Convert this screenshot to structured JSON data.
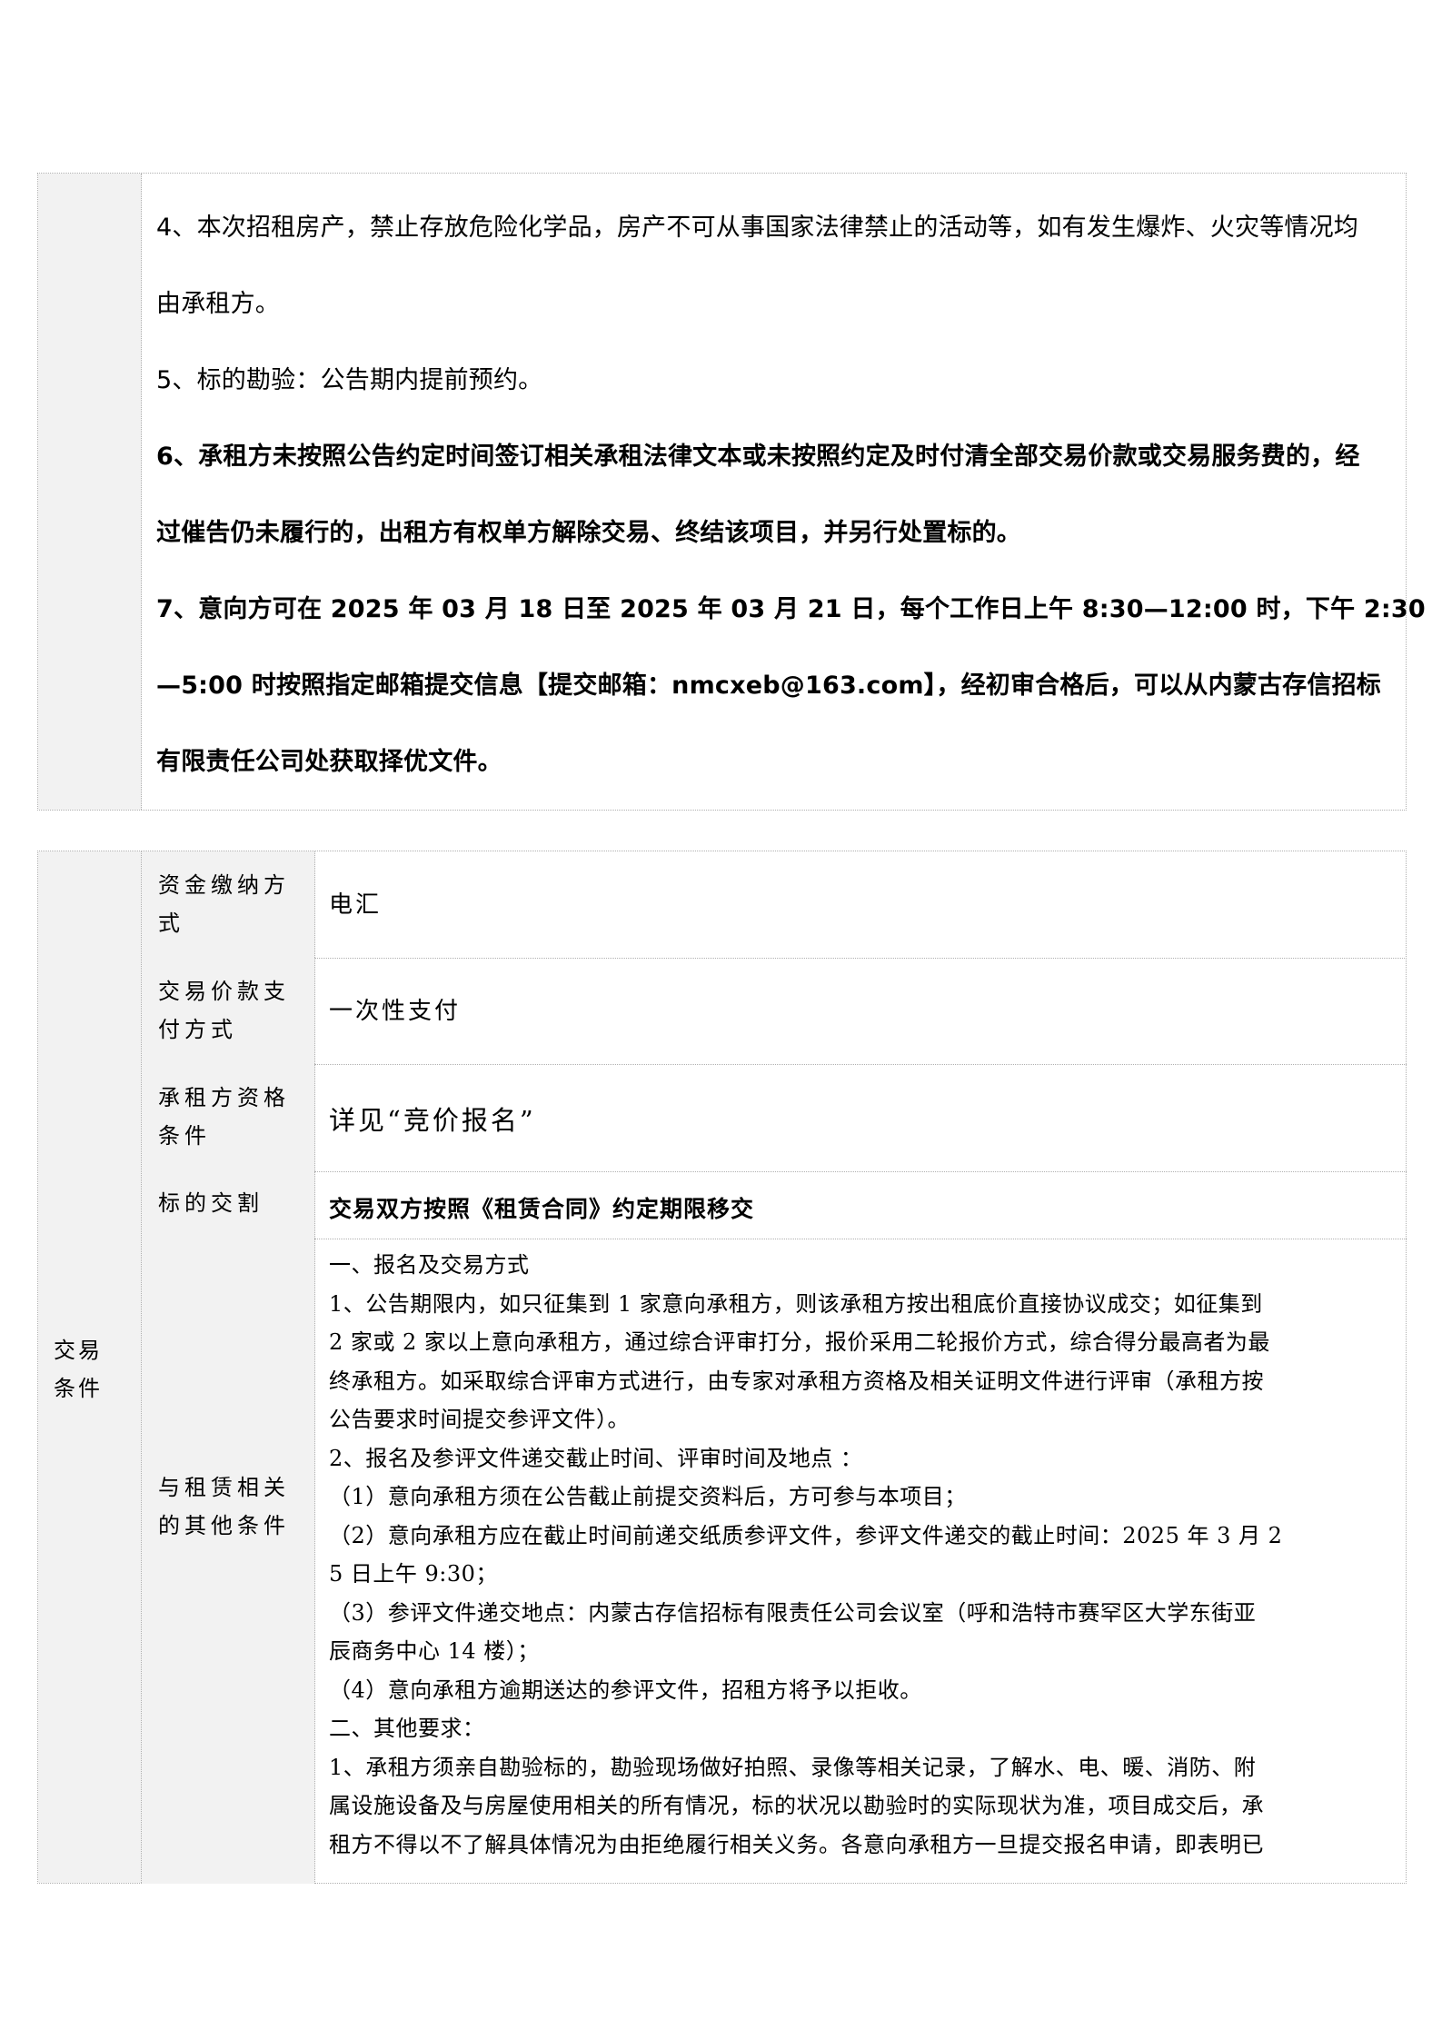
{
  "terms": {
    "l1": "4、本次招租房产，禁止存放危险化学品，房产不可从事国家法律禁止的活动等，如有发生爆炸、火灾等情况均",
    "l2": "由承租方。",
    "l3": "5、标的勘验：公告期内提前预约。",
    "l4": "6、承租方未按照公告约定时间签订相关承租法律文本或未按照约定及时付清全部交易价款或交易服务费的，经",
    "l5": "过催告仍未履行的，出租方有权单方解除交易、终结该项目，并另行处置标的。",
    "l6": "7、意向方可在 2025 年 03 月 18 日至 2025 年 03 月 21 日，每个工作日上午 8:30—12:00  时，下午  2:30",
    "l7": "—5:00  时按照指定邮箱提交信息【提交邮箱：nmcxeb@163.com】，经初审合格后，可以从内蒙古存信招标",
    "l8": "有限责任公司处获取择优文件。"
  },
  "trade": {
    "section_label_1": "交易",
    "section_label_2": "条件",
    "rows": {
      "payment_method_label": "资金缴纳方式",
      "payment_method_value": "电汇",
      "price_payment_label": "交易价款支付方式",
      "price_payment_value": "一次性支付",
      "qualification_label": "承租方资格条件",
      "qualification_value": "详见“竞价报名”",
      "delivery_label": "标的交割",
      "delivery_value": "交易双方按照《租赁合同》约定期限移交",
      "other_label": "与租赁相关的其他条件"
    },
    "other_lines": [
      "一、报名及交易方式",
      "1、公告期限内，如只征集到 1 家意向承租方，则该承租方按出租底价直接协议成交；如征集到",
      "2 家或 2 家以上意向承租方，通过综合评审打分，报价采用二轮报价方式，综合得分最高者为最",
      "终承租方。如采取综合评审方式进行，由专家对承租方资格及相关证明文件进行评审（承租方按",
      "公告要求时间提交参评文件）。",
      "2、报名及参评文件递交截止时间、评审时间及地点 ：",
      "（1）意向承租方须在公告截止前提交资料后，方可参与本项目；",
      "（2）意向承租方应在截止时间前递交纸质参评文件，参评文件递交的截止时间：2025 年 3 月 2",
      "5 日上午 9:30；",
      "（3）参评文件递交地点：内蒙古存信招标有限责任公司会议室（呼和浩特市赛罕区大学东街亚",
      "辰商务中心 14 楼）；",
      "（4）意向承租方逾期送达的参评文件，招租方将予以拒收。",
      "二、其他要求：",
      "1、承租方须亲自勘验标的，勘验现场做好拍照、录像等相关记录，了解水、电、暖、消防、附",
      "属设施设备及与房屋使用相关的所有情况，标的状况以勘验时的实际现状为准，项目成交后，承",
      "租方不得以不了解具体情况为由拒绝履行相关义务。各意向承租方一旦提交报名申请，即表明已"
    ]
  }
}
